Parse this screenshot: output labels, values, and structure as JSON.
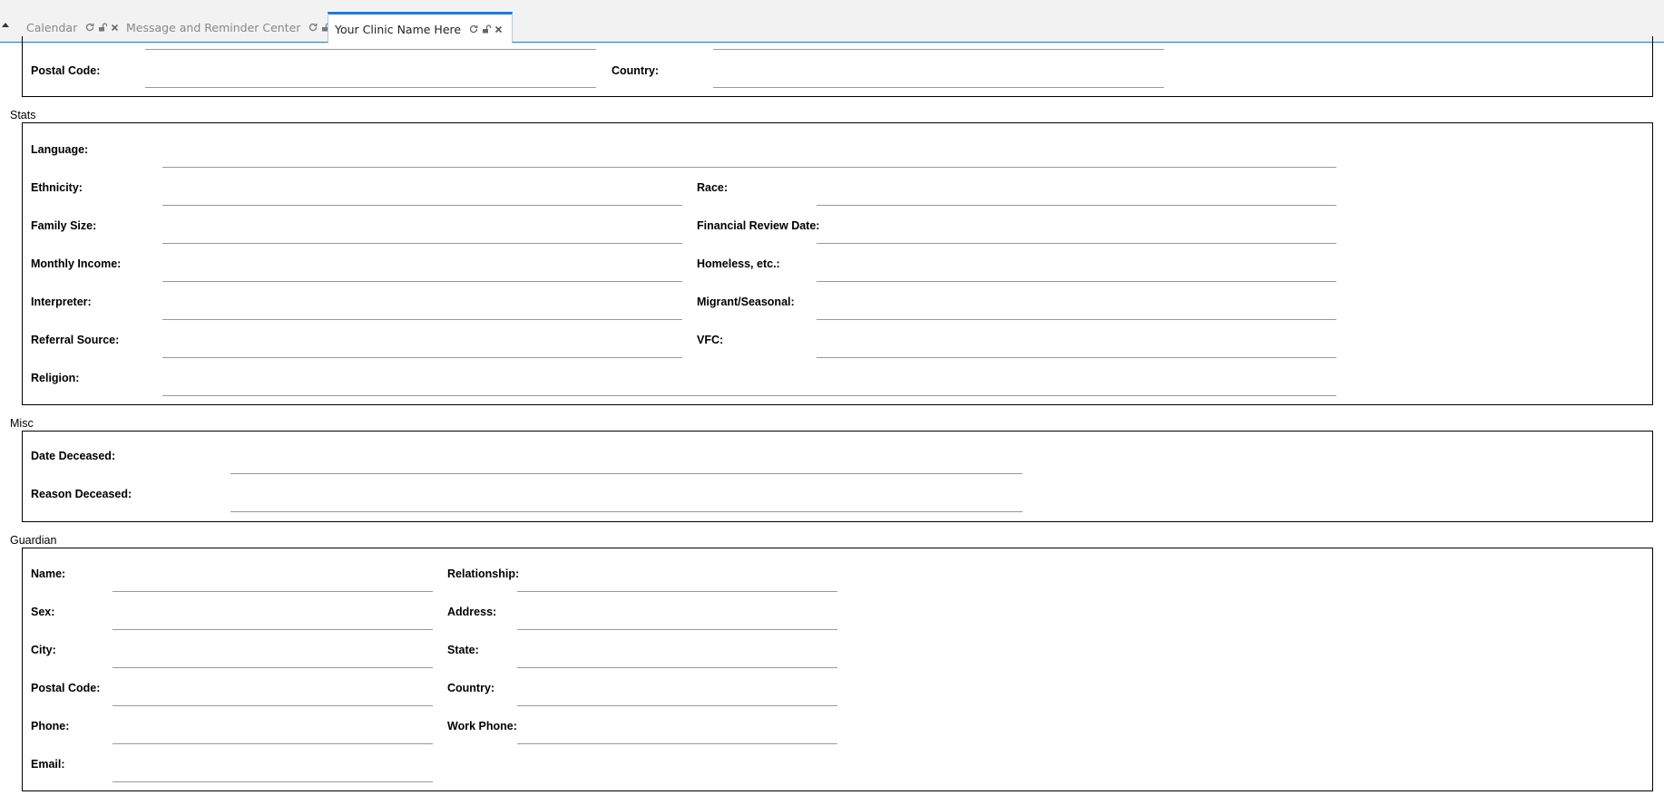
{
  "tabs": [
    {
      "label": "Calendar",
      "active": false
    },
    {
      "label": "Message and Reminder Center",
      "active": false
    },
    {
      "label": "Your Clinic Name Here",
      "active": true
    }
  ],
  "icons": {
    "collapse": "caret-up-icon",
    "refresh": "refresh-icon",
    "unlock": "unlock-icon",
    "close": "close-icon"
  },
  "colors": {
    "accent": "#1c7bd4",
    "tabbar_bg": "#f2f2f2",
    "field_underline": "#999999"
  },
  "address_section": {
    "postal_code_label": "Postal Code:",
    "country_label": "Country:",
    "postal_code": "",
    "country": ""
  },
  "stats": {
    "title": "Stats",
    "language_label": "Language:",
    "ethnicity_label": "Ethnicity:",
    "race_label": "Race:",
    "family_size_label": "Family Size:",
    "financial_review_date_label": "Financial Review Date:",
    "monthly_income_label": "Monthly Income:",
    "homeless_label": "Homeless, etc.:",
    "interpreter_label": "Interpreter:",
    "migrant_label": "Migrant/Seasonal:",
    "referral_source_label": "Referral Source:",
    "vfc_label": "VFC:",
    "religion_label": "Religion:"
  },
  "misc": {
    "title": "Misc",
    "date_deceased_label": "Date Deceased:",
    "reason_deceased_label": "Reason Deceased:"
  },
  "guardian": {
    "title": "Guardian",
    "name_label": "Name:",
    "relationship_label": "Relationship:",
    "sex_label": "Sex:",
    "address_label": "Address:",
    "city_label": "City:",
    "state_label": "State:",
    "postal_code_label": "Postal Code:",
    "country_label": "Country:",
    "phone_label": "Phone:",
    "work_phone_label": "Work Phone:",
    "email_label": "Email:"
  }
}
